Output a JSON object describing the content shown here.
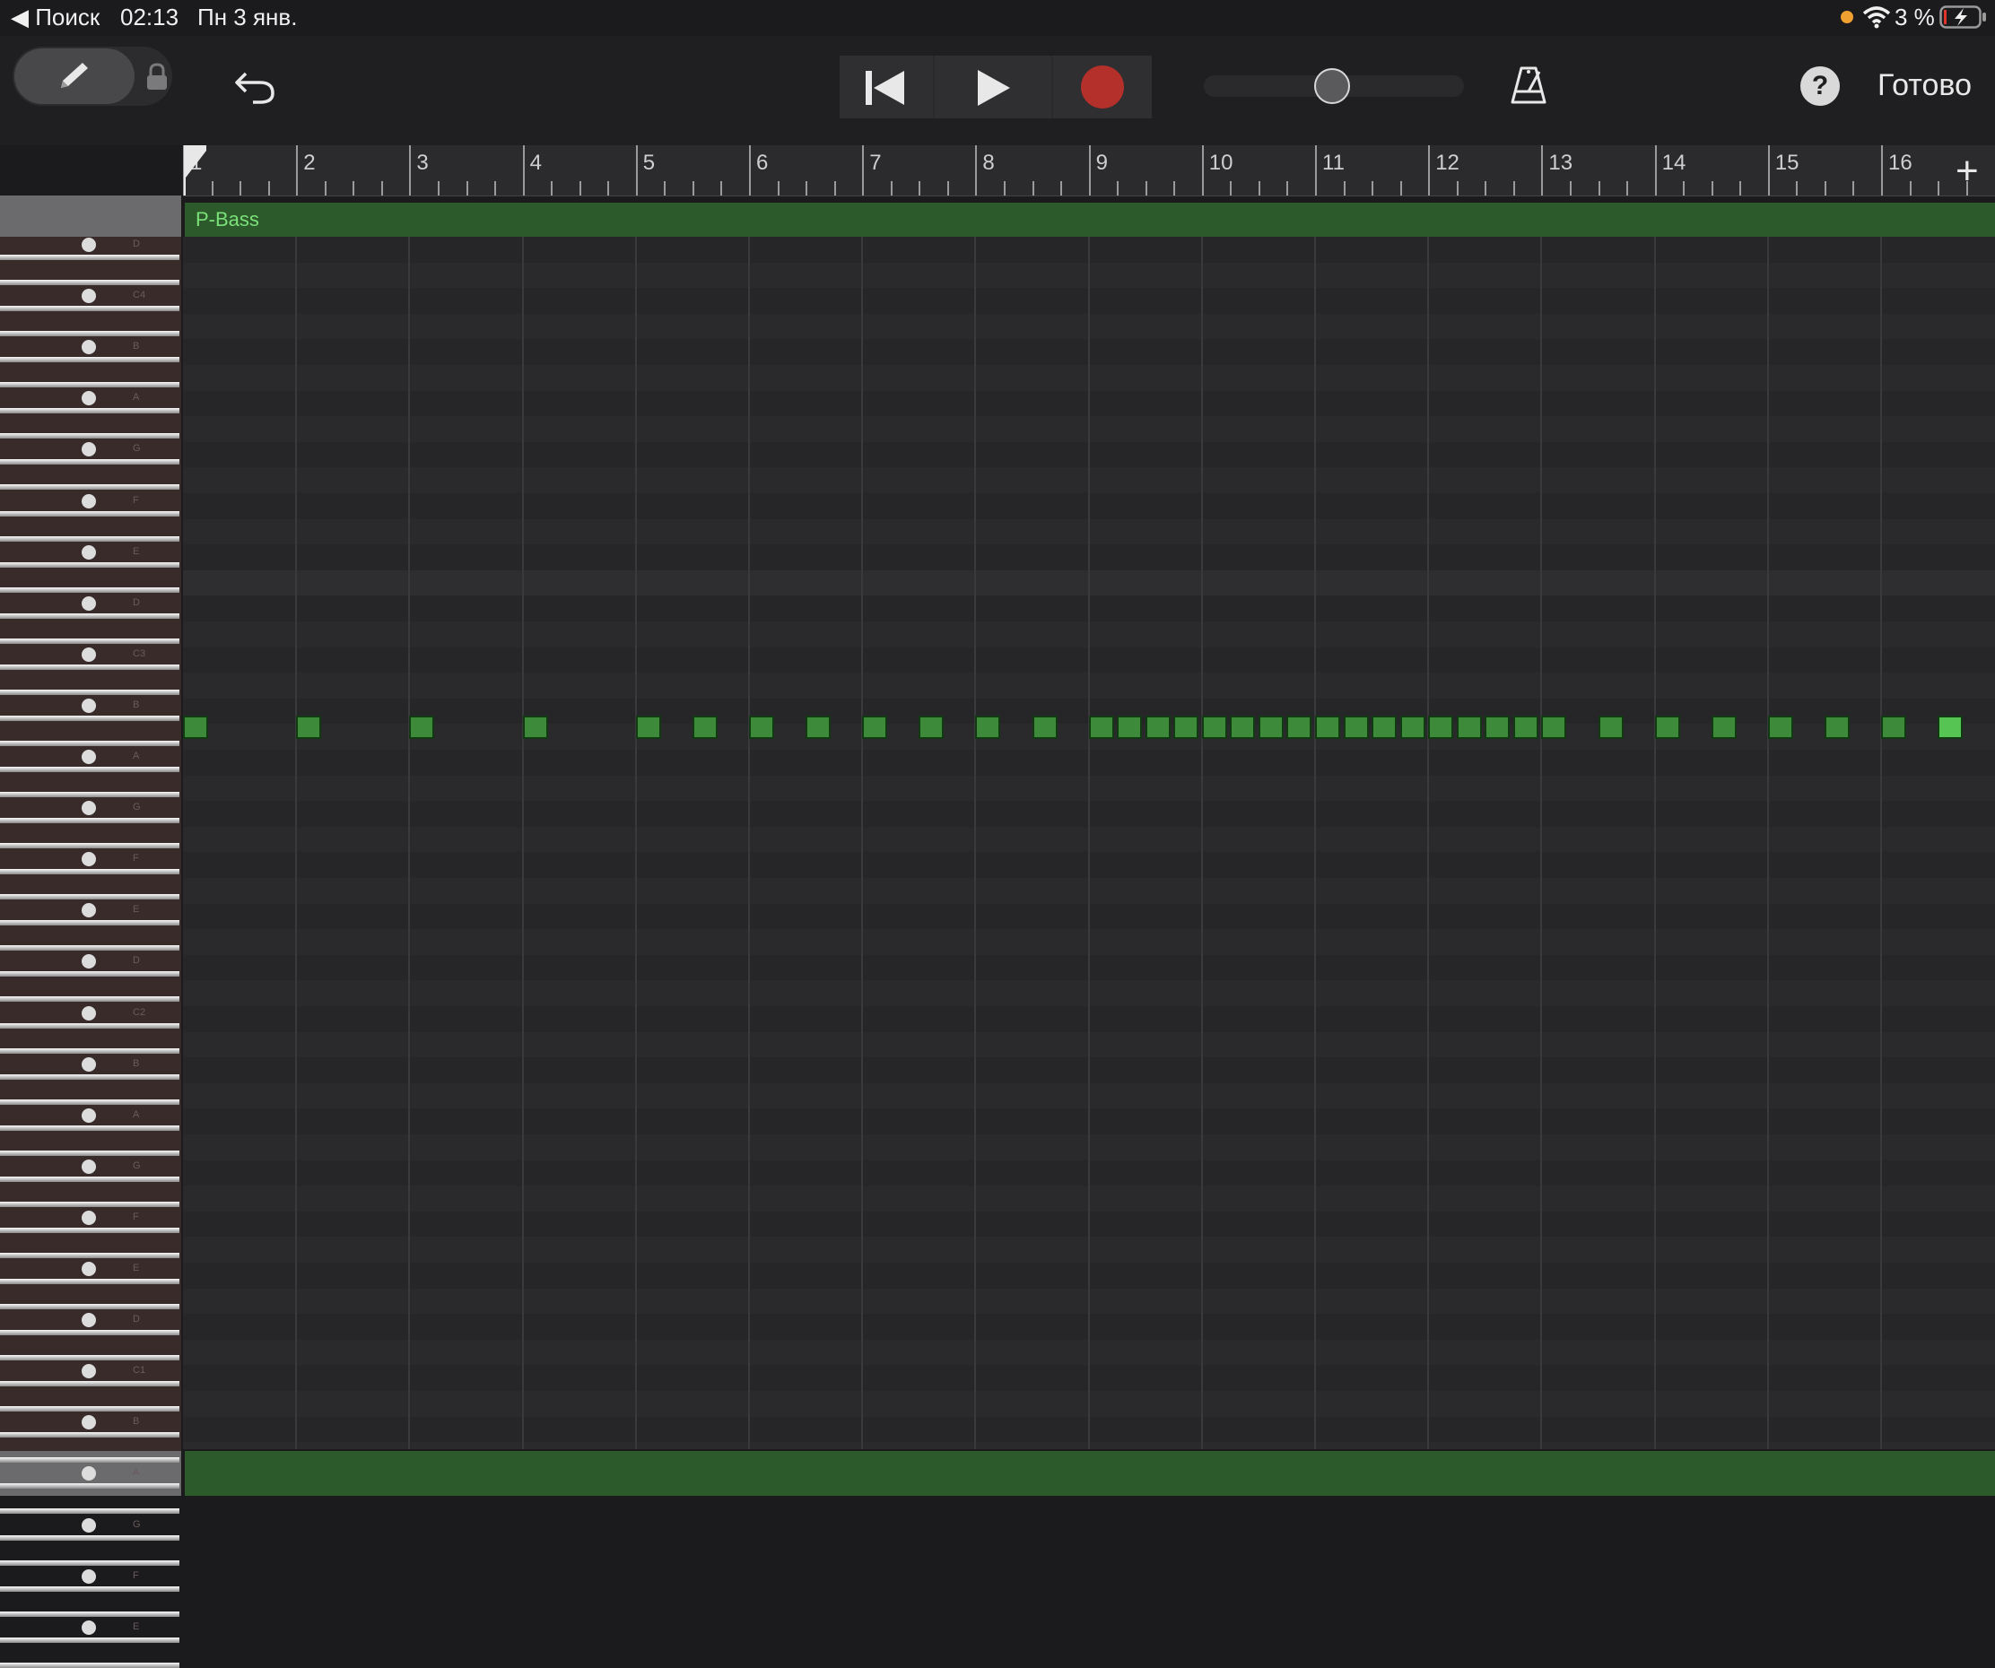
{
  "status_bar": {
    "back_label": "◀ Поиск",
    "time": "02:13",
    "date": "Пн 3 янв.",
    "battery": "3 %",
    "battery_color": "#e0332a",
    "indicator_color": "#f0a030"
  },
  "toolbar": {
    "pencil_icon": "pencil-icon",
    "lock_icon": "lock-icon",
    "undo_icon": "undo-icon",
    "rewind_icon": "rewind-icon",
    "play_icon": "play-icon",
    "record_icon": "record-icon",
    "record_color": "#b3302b",
    "volume_level": 0.45,
    "metronome_icon": "metronome-icon",
    "help_label": "?",
    "done_label": "Готово"
  },
  "ruler": {
    "bars": [
      "1",
      "2",
      "3",
      "4",
      "5",
      "6",
      "7",
      "8",
      "9",
      "10",
      "11",
      "12",
      "13",
      "14",
      "15",
      "16"
    ],
    "add_label": "+"
  },
  "region": {
    "name": "P-Bass",
    "color": "#2c5a2a"
  },
  "fretboard": {
    "note_labels": [
      "D",
      "C4",
      "B",
      "A",
      "G",
      "F",
      "E",
      "D",
      "C3",
      "B",
      "A",
      "G",
      "F",
      "E",
      "D",
      "C2",
      "B",
      "A",
      "G",
      "F",
      "E",
      "D",
      "C1",
      "B",
      "A",
      "G",
      "F",
      "E"
    ]
  },
  "notes": {
    "pitch": "G",
    "starts_beats": [
      0,
      4,
      8,
      12,
      16,
      18,
      20,
      22,
      24,
      26,
      28,
      30,
      32,
      33,
      34,
      35,
      36,
      37,
      38,
      39,
      40,
      41,
      42,
      43,
      44,
      45,
      46,
      47,
      48,
      50,
      52,
      54,
      56,
      58,
      60,
      62
    ],
    "color": "#3c8a3a",
    "last_color": "#55c453"
  }
}
